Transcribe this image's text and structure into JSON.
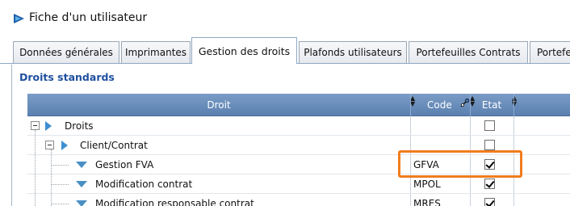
{
  "window": {
    "title": "Fiche d'un utilisateur"
  },
  "tabs": [
    {
      "label": "Données générales",
      "active": false
    },
    {
      "label": "Imprimantes",
      "active": false
    },
    {
      "label": "Gestion des droits",
      "active": true
    },
    {
      "label": "Plafonds utilisateurs",
      "active": false
    },
    {
      "label": "Portefeuilles Contrats",
      "active": false
    },
    {
      "label": "Portefe",
      "active": false
    }
  ],
  "section": {
    "label": "Droits standards"
  },
  "grid": {
    "columns": {
      "droit": "Droit",
      "code": "Code",
      "etat": "Etat"
    },
    "rows": [
      {
        "label": "Droits",
        "code": "",
        "checked": false,
        "level": 0,
        "kind": "group"
      },
      {
        "label": "Client/Contrat",
        "code": "",
        "checked": false,
        "level": 1,
        "kind": "group"
      },
      {
        "label": "Gestion FVA",
        "code": "GFVA",
        "checked": true,
        "level": 2,
        "kind": "leaf"
      },
      {
        "label": "Modification contrat",
        "code": "MPOL",
        "checked": true,
        "level": 2,
        "kind": "leaf"
      },
      {
        "label": "Modification responsable contrat",
        "code": "MRES",
        "checked": true,
        "level": 2,
        "kind": "leaf"
      }
    ]
  },
  "colors": {
    "highlight": "#f07d1e",
    "header": "#6b8fbd",
    "section_label": "#1f4f9f"
  },
  "icons": {
    "app": "app-logo-icon",
    "expand": "collapse-minus-icon",
    "group": "triangle-right-icon",
    "leaf": "triangle-down-icon",
    "sort": "sort-arrows-icon",
    "tool": "pin-tool-icon"
  }
}
